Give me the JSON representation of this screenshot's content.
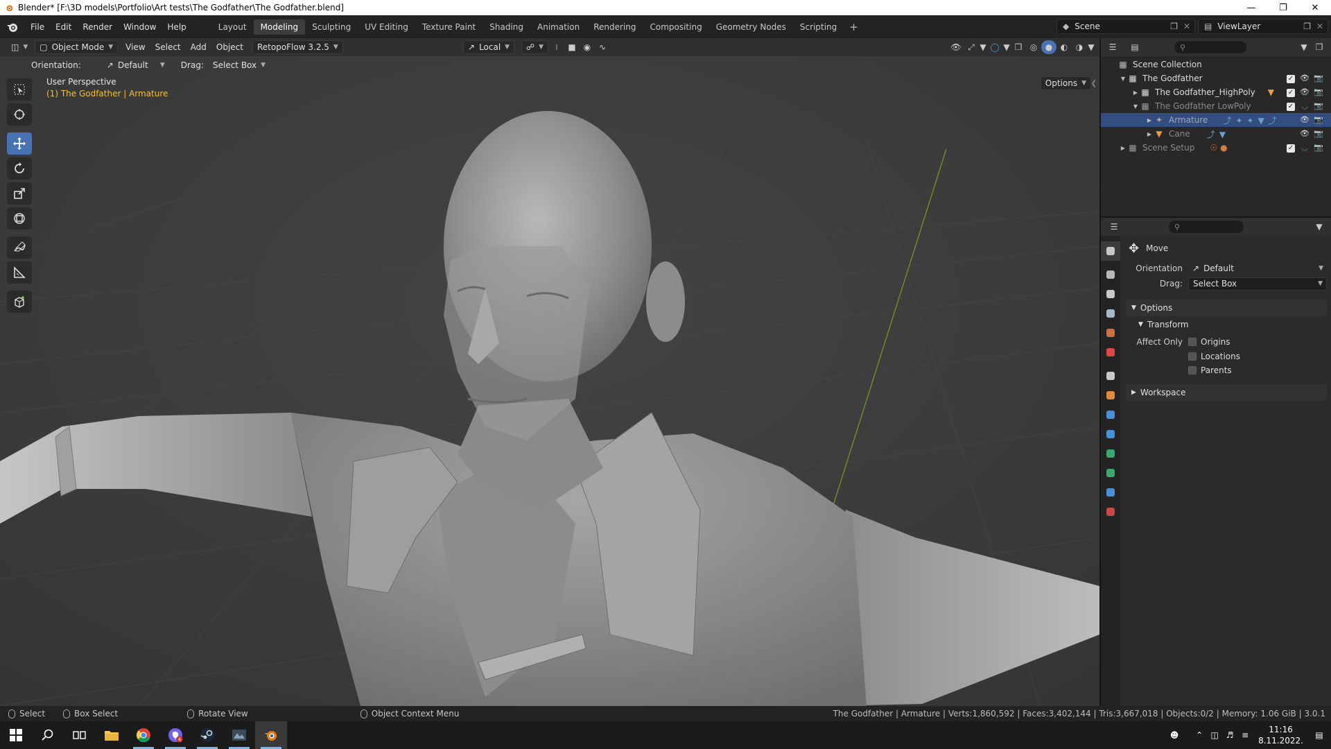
{
  "window": {
    "title": "Blender* [F:\\3D models\\Portfolio\\Art tests\\The Godfather\\The Godfather.blend]",
    "controls": [
      "minimize-icon",
      "restore-icon",
      "close-icon"
    ]
  },
  "menubar": {
    "items": [
      "File",
      "Edit",
      "Render",
      "Window",
      "Help"
    ],
    "workspaces": [
      "Layout",
      "Modeling",
      "Sculpting",
      "UV Editing",
      "Texture Paint",
      "Shading",
      "Animation",
      "Rendering",
      "Compositing",
      "Geometry Nodes",
      "Scripting"
    ],
    "active_workspace": "Modeling",
    "scene": "Scene",
    "view_layer": "ViewLayer"
  },
  "viewport": {
    "mode": "Object Mode",
    "menus": [
      "View",
      "Select",
      "Add",
      "Object"
    ],
    "addon": "RetopoFlow 3.2.5",
    "transform_orientation": "Local",
    "tool_settings": {
      "orientation_label": "Orientation:",
      "orientation_value": "Default",
      "drag_label": "Drag:",
      "drag_value": "Select Box",
      "options": "Options"
    },
    "overlay_title": "User Perspective",
    "overlay_object": "(1) The Godfather | Armature",
    "tools": [
      "select-box-icon",
      "cursor-icon",
      "move-icon",
      "rotate-icon",
      "scale-icon",
      "transform-icon",
      "annotate-icon",
      "measure-icon",
      "add-cube-icon"
    ],
    "active_tool": "move-icon"
  },
  "outliner": {
    "root": "Scene Collection",
    "rows": [
      {
        "label": "The Godfather",
        "depth": 1,
        "expanded": true,
        "type": "collection",
        "selected": false,
        "dim": false
      },
      {
        "label": "The Godfather_HighPoly",
        "depth": 2,
        "expanded": false,
        "type": "collection",
        "selected": false,
        "dim": false
      },
      {
        "label": "The Godfather LowPoly",
        "depth": 2,
        "expanded": true,
        "type": "collection",
        "selected": false,
        "dim": true
      },
      {
        "label": "Armature",
        "depth": 3,
        "expanded": false,
        "type": "armature",
        "selected": true,
        "dim": true
      },
      {
        "label": "Cane",
        "depth": 3,
        "expanded": false,
        "type": "mesh",
        "selected": false,
        "dim": true
      },
      {
        "label": "Scene Setup",
        "depth": 1,
        "expanded": false,
        "type": "collection",
        "selected": false,
        "dim": true
      }
    ]
  },
  "properties": {
    "tool_name": "Move",
    "orientation_label": "Orientation",
    "orientation_value": "Default",
    "drag_label": "Drag:",
    "drag_value": "Select Box",
    "panel_options": "Options",
    "panel_transform": "Transform",
    "affect_only_label": "Affect Only",
    "checkboxes": [
      "Origins",
      "Locations",
      "Parents"
    ],
    "panel_workspace": "Workspace",
    "tab_colors": [
      "#c8c8c8",
      "#b8b8b8",
      "#c8c8c8",
      "#a8b8c8",
      "#c87040",
      "#e04848",
      "#c8c8c8",
      "#e08a3c",
      "#4a90d9",
      "#4a90d9",
      "#3aa870",
      "#3aa870",
      "#4a90d9",
      "#c84848"
    ]
  },
  "statusbar": {
    "select": "Select",
    "box_select": "Box Select",
    "rotate_view": "Rotate View",
    "context_menu": "Object Context Menu",
    "stats": "The Godfather | Armature | Verts:1,860,592 | Faces:3,402,144 | Tris:3,667,018 | Objects:0/2 | Memory: 1.06 GiB | 3.0.1"
  },
  "taskbar": {
    "apps": [
      "start-icon",
      "search-icon",
      "task-view-icon",
      "file-explorer-icon",
      "chrome-icon",
      "viber-icon",
      "steam-icon",
      "game-icon",
      "blender-icon"
    ],
    "time": "11:16",
    "date": "8.11.2022."
  }
}
